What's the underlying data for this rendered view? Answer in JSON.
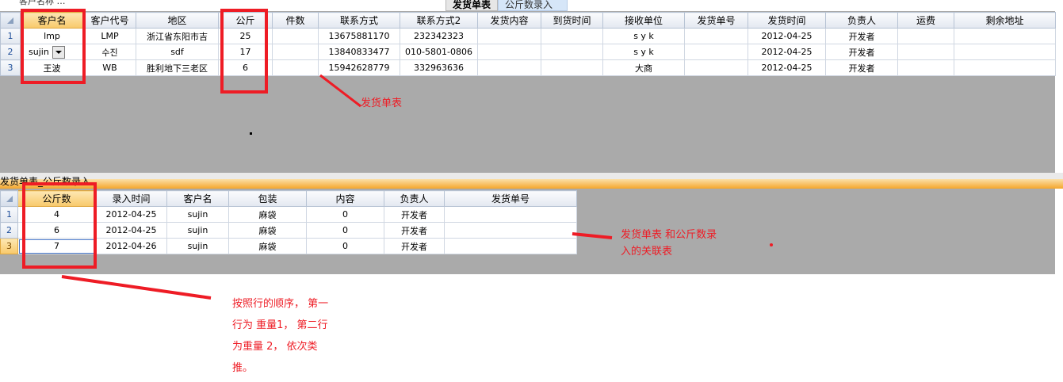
{
  "tabs": {
    "cropped_left": "客户名称 …",
    "active": "发货单表",
    "inactive": "公斤数录入"
  },
  "top_grid": {
    "columns": [
      "客户名",
      "客户代号",
      "地区",
      "公斤",
      "件数",
      "联系方式",
      "联系方式2",
      "发货内容",
      "到货时间",
      "接收单位",
      "发货单号",
      "发货时间",
      "负责人",
      "运费",
      "剩余地址"
    ],
    "rows": [
      {
        "num": "1",
        "cells": [
          "lmp",
          "LMP",
          "浙江省东阳市吉",
          "25",
          "",
          "13675881170",
          "232342323",
          "",
          "",
          "s y k",
          "",
          "2012-04-25",
          "开发者",
          "",
          ""
        ]
      },
      {
        "num": "2",
        "cells": [
          "sujin",
          "수진",
          "sdf",
          "17",
          "",
          "13840833477",
          "010-5801-0806",
          "",
          "",
          "s y k",
          "",
          "2012-04-25",
          "开发者",
          "",
          ""
        ]
      },
      {
        "num": "3",
        "cells": [
          "王波",
          "WB",
          "胜利地下三老区",
          "6",
          "",
          "15942628779",
          "332963636",
          "",
          "",
          "大商",
          "",
          "2012-04-25",
          "开发者",
          "",
          ""
        ]
      }
    ]
  },
  "bottom_caption": "发货单表_公斤数录入",
  "bottom_grid": {
    "columns": [
      "公斤数",
      "录入时间",
      "客户名",
      "包装",
      "内容",
      "负责人",
      "发货单号"
    ],
    "rows": [
      {
        "num": "1",
        "cells": [
          "4",
          "2012-04-25",
          "sujin",
          "麻袋",
          "0",
          "开发者",
          ""
        ]
      },
      {
        "num": "2",
        "cells": [
          "6",
          "2012-04-25",
          "sujin",
          "麻袋",
          "0",
          "开发者",
          ""
        ]
      },
      {
        "num": "3",
        "cells": [
          "7",
          "2012-04-26",
          "sujin",
          "麻袋",
          "0",
          "开发者",
          ""
        ]
      }
    ]
  },
  "annotations": {
    "note1": "发货单表",
    "note2_line1": "发货单表 和公斤数录",
    "note2_line2": "入的关联表",
    "note3_line1": "按照行的顺序， 第一",
    "note3_line2": "行为 重量1， 第二行",
    "note3_line3": "为重量 2， 依次类",
    "note3_line4": "推。"
  },
  "colors": {
    "annotation_red": "#ee1c25",
    "grid_gray": "#aaaaaa",
    "selected_header": "#f8c96a"
  }
}
